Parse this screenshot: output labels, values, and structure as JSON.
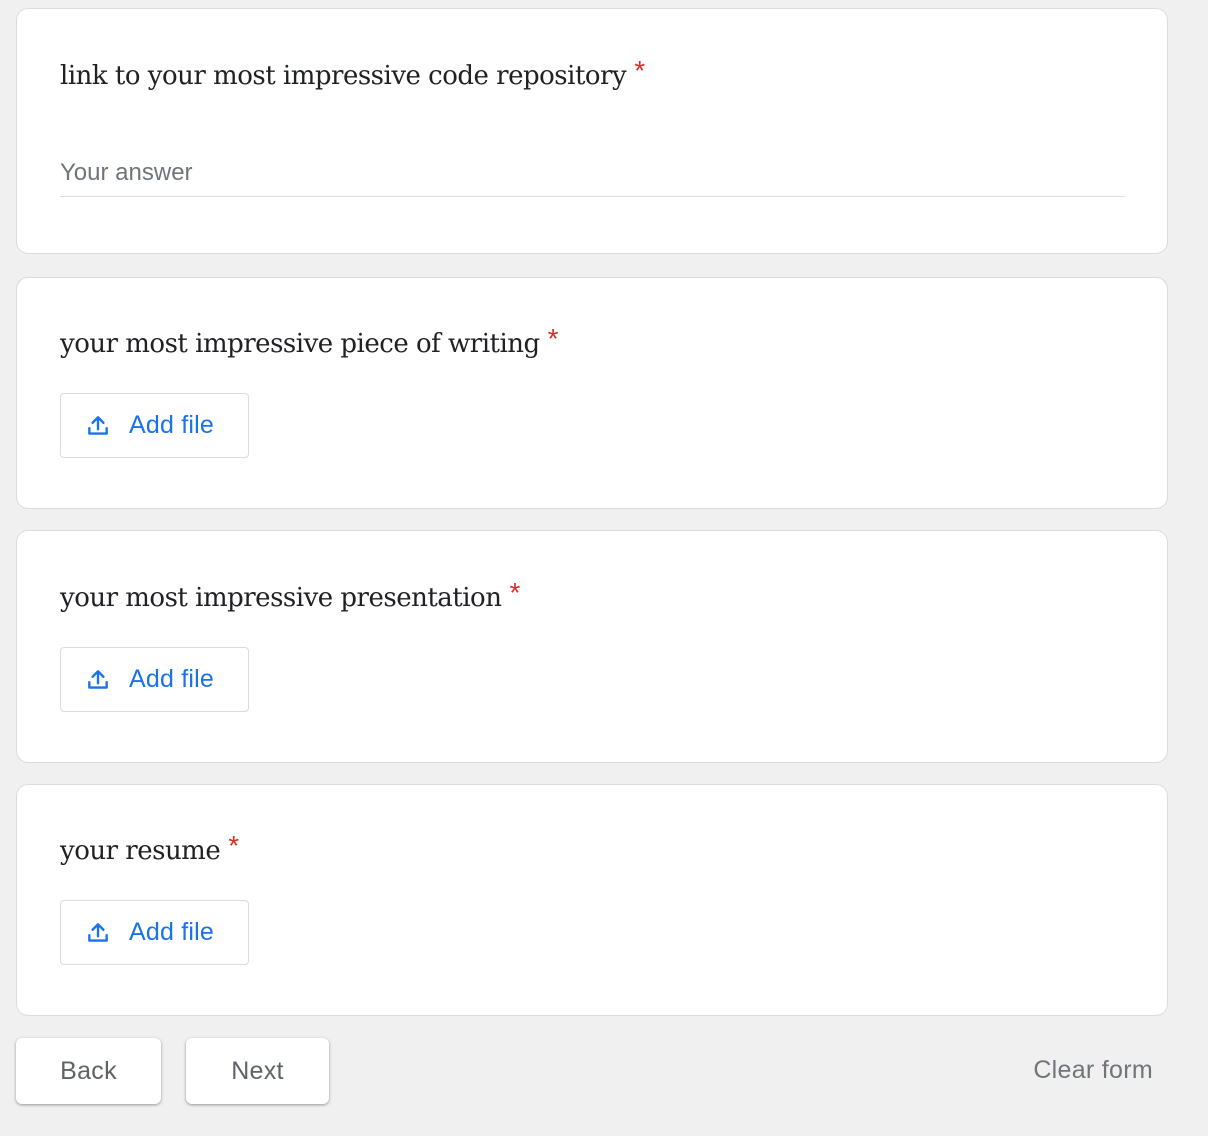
{
  "questions": [
    {
      "title": "link to your most impressive code repository",
      "required_mark": "*",
      "type": "short-answer",
      "placeholder": "Your answer",
      "value": ""
    },
    {
      "title": "your most impressive piece of writing",
      "required_mark": "*",
      "type": "file-upload",
      "button_label": "Add file",
      "icon": "upload-icon"
    },
    {
      "title": "your most impressive presentation",
      "required_mark": "*",
      "type": "file-upload",
      "button_label": "Add file",
      "icon": "upload-icon"
    },
    {
      "title": "your resume",
      "required_mark": "*",
      "type": "file-upload",
      "button_label": "Add file",
      "icon": "upload-icon"
    }
  ],
  "navigation": {
    "back_label": "Back",
    "next_label": "Next",
    "clear_label": "Clear form"
  },
  "colors": {
    "background": "#f0f0f0",
    "card": "#ffffff",
    "required": "#d93025",
    "accent": "#1a73e8",
    "muted_text": "#5f6368"
  }
}
